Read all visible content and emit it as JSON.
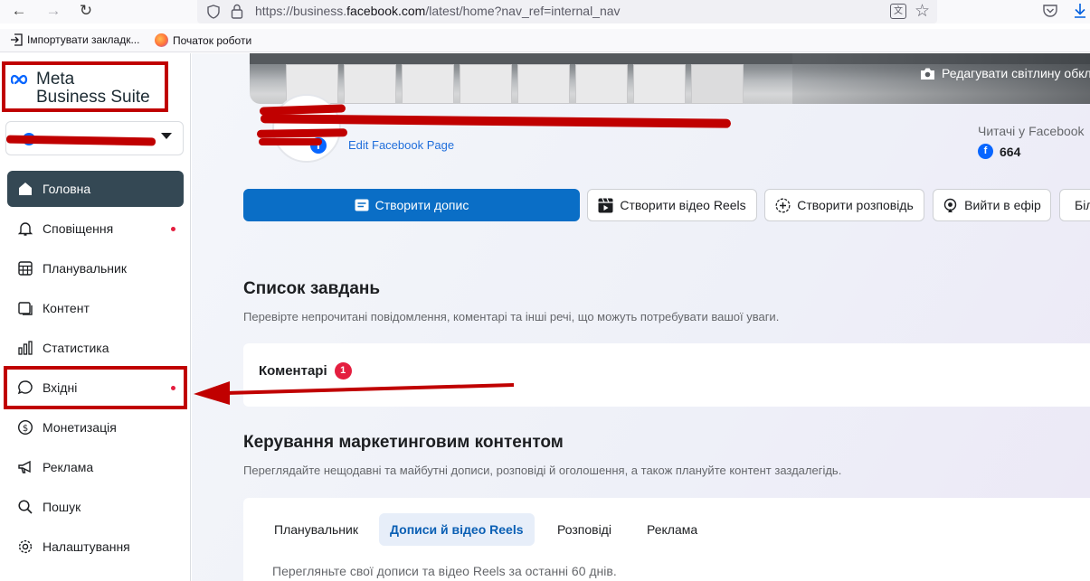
{
  "browser": {
    "url_prefix": "https://business.",
    "url_domain": "facebook.com",
    "url_suffix": "/latest/home?nav_ref=internal_nav",
    "bookmarks": [
      {
        "label": "Імпортувати закладк..."
      },
      {
        "label": "Початок роботи"
      }
    ]
  },
  "sidebar": {
    "logo_line1": "Meta",
    "logo_line2": "Business Suite",
    "items": [
      {
        "label": "Головна",
        "icon": "home-icon",
        "active": true
      },
      {
        "label": "Сповіщення",
        "icon": "bell-icon",
        "dot": true
      },
      {
        "label": "Планувальник",
        "icon": "calendar-icon"
      },
      {
        "label": "Контент",
        "icon": "content-icon"
      },
      {
        "label": "Статистика",
        "icon": "chart-icon"
      },
      {
        "label": "Вхідні",
        "icon": "chat-bubble-icon",
        "dot": true,
        "highlighted": true
      },
      {
        "label": "Монетизація",
        "icon": "dollar-icon"
      },
      {
        "label": "Реклама",
        "icon": "megaphone-icon"
      },
      {
        "label": "Пошук",
        "icon": "search-icon"
      },
      {
        "label": "Налаштування",
        "icon": "gear-icon"
      }
    ]
  },
  "header": {
    "cover_edit": "Редагувати світлину обкладинки",
    "edit_page": "Edit Facebook Page",
    "followers_label": "Читачі у Facebook",
    "followers_count": "664"
  },
  "actions": [
    {
      "label": "Створити допис",
      "icon": "post-icon",
      "primary": true
    },
    {
      "label": "Створити відео Reels",
      "icon": "reels-icon"
    },
    {
      "label": "Створити розповідь",
      "icon": "story-icon"
    },
    {
      "label": "Вийти в ефір",
      "icon": "live-icon"
    },
    {
      "label": "Біл",
      "icon": ""
    }
  ],
  "tasks": {
    "title": "Список завдань",
    "subtitle": "Перевірте непрочитані повідомлення, коментарі та інші речі, що можуть потребувати вашої уваги.",
    "comments_label": "Коментарі",
    "comments_count": "1"
  },
  "marketing": {
    "title": "Керування маркетинговим контентом",
    "subtitle": "Переглядайте нещодавні та майбутні дописи, розповіді й оголошення, а також плануйте контент заздалегідь.",
    "tabs": [
      {
        "label": "Планувальник"
      },
      {
        "label": "Дописи й відео Reels",
        "active": true
      },
      {
        "label": "Розповіді"
      },
      {
        "label": "Реклама"
      }
    ],
    "note": "Перегляньте свої дописи та відео Reels за останні 60 днів."
  },
  "colors": {
    "accent": "#0a6ec6",
    "active_nav": "#344854",
    "annotation": "#c00000"
  }
}
